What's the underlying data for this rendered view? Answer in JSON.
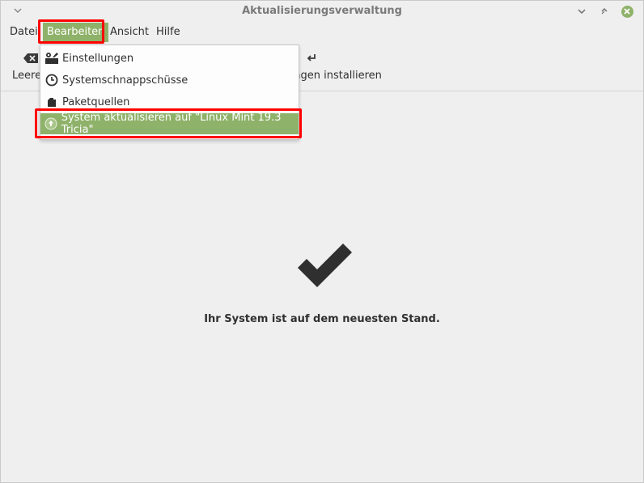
{
  "window": {
    "title": "Aktualisierungsverwaltung"
  },
  "menubar": {
    "items": [
      {
        "label": "Datei"
      },
      {
        "label": "Bearbeiten"
      },
      {
        "label": "Ansicht"
      },
      {
        "label": "Hilfe"
      }
    ]
  },
  "toolbar": {
    "clear_label": "Leeren",
    "install_label": "ungen installieren"
  },
  "edit_menu": {
    "items": [
      {
        "label": "Einstellungen",
        "icon": "preferences-icon"
      },
      {
        "label": "Systemschnappschüsse",
        "icon": "clock-icon"
      },
      {
        "label": "Paketquellen",
        "icon": "package-icon"
      },
      {
        "label": "System aktualisieren auf \"Linux Mint 19.3 Tricia\"",
        "icon": "upgrade-arrow-icon"
      }
    ]
  },
  "main": {
    "status_text": "Ihr System ist auf dem neuesten Stand."
  },
  "colors": {
    "accent": "#8fb26a",
    "highlight_box": "#ff0000",
    "background": "#efefef"
  }
}
